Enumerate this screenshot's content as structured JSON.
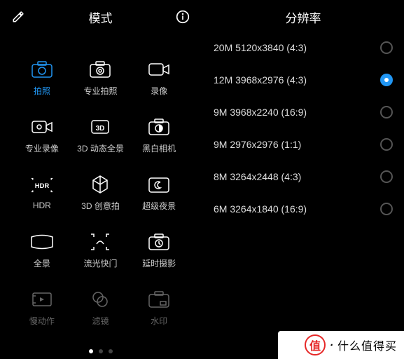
{
  "left": {
    "title": "模式",
    "modes": [
      {
        "label": "拍照",
        "icon": "camera",
        "active": true
      },
      {
        "label": "专业拍照",
        "icon": "pro-camera"
      },
      {
        "label": "录像",
        "icon": "video"
      },
      {
        "label": "专业录像",
        "icon": "pro-video"
      },
      {
        "label": "3D 动态全景",
        "icon": "3d"
      },
      {
        "label": "黑白相机",
        "icon": "mono-camera"
      },
      {
        "label": "HDR",
        "icon": "hdr"
      },
      {
        "label": "3D 创意拍",
        "icon": "cube"
      },
      {
        "label": "超级夜景",
        "icon": "night"
      },
      {
        "label": "全景",
        "icon": "panorama"
      },
      {
        "label": "流光快门",
        "icon": "light-paint"
      },
      {
        "label": "延时摄影",
        "icon": "timelapse"
      },
      {
        "label": "慢动作",
        "icon": "slowmo",
        "faded": true
      },
      {
        "label": "滤镜",
        "icon": "filter",
        "faded": true
      },
      {
        "label": "水印",
        "icon": "watermark",
        "faded": true
      }
    ],
    "page_current": 1,
    "page_total": 3
  },
  "right": {
    "title": "分辨率",
    "options": [
      {
        "label": "20M 5120x3840 (4:3)",
        "selected": false
      },
      {
        "label": "12M 3968x2976 (4:3)",
        "selected": true
      },
      {
        "label": "9M 3968x2240 (16:9)",
        "selected": false
      },
      {
        "label": "9M 2976x2976 (1:1)",
        "selected": false
      },
      {
        "label": "8M 3264x2448 (4:3)",
        "selected": false
      },
      {
        "label": "6M 3264x1840 (16:9)",
        "selected": false
      }
    ]
  },
  "watermark": {
    "brand": "值",
    "text": "什么值得买"
  }
}
